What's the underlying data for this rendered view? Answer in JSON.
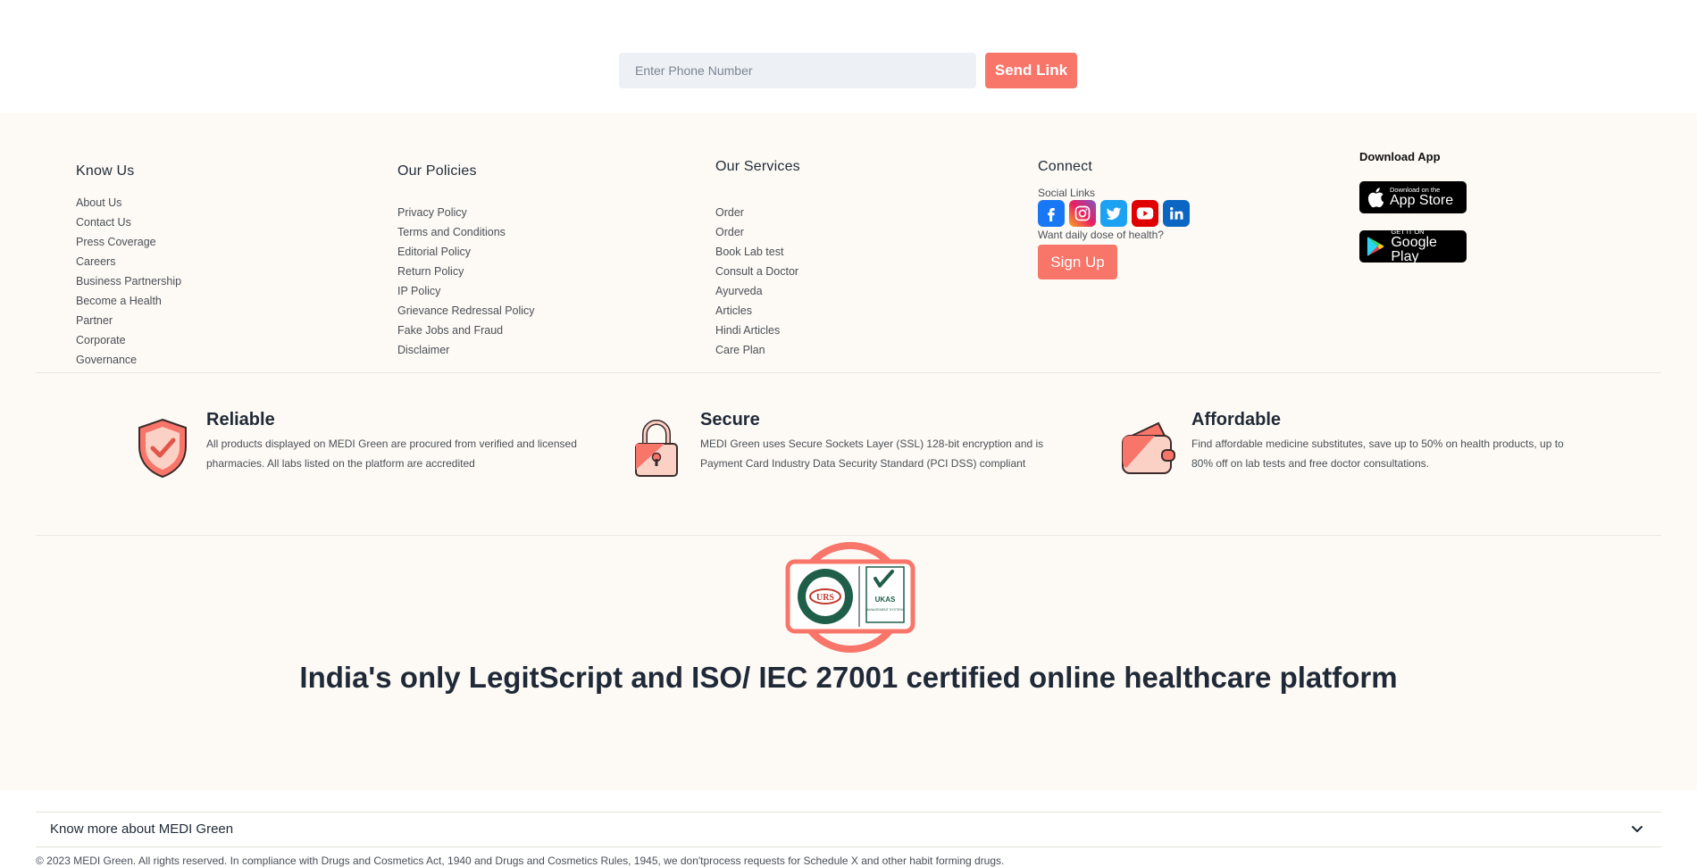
{
  "phone_form": {
    "placeholder": "Enter Phone Number",
    "send_label": "Send Link"
  },
  "footer": {
    "know_us": {
      "heading": "Know Us",
      "items": [
        "About Us",
        "Contact Us",
        "Press Coverage",
        "Careers",
        "Business Partnership",
        "Become a Health",
        "Partner",
        "Corporate",
        "Governance"
      ]
    },
    "policies": {
      "heading": "Our Policies",
      "items": [
        "Privacy Policy",
        "Terms and Conditions",
        "Editorial Policy",
        "Return Policy",
        "IP Policy",
        "Grievance Redressal Policy",
        "Fake Jobs and Fraud",
        "Disclaimer"
      ]
    },
    "services": {
      "heading": "Our Services",
      "items": [
        "Order",
        "Order",
        "Book Lab test",
        "Consult a Doctor",
        "Ayurveda",
        "Articles",
        "Hindi Articles",
        "Care Plan"
      ]
    },
    "connect": {
      "heading": "Connect",
      "social_label": "Social Links",
      "socials": [
        "facebook-icon",
        "instagram-icon",
        "twitter-icon",
        "youtube-icon",
        "linkedin-icon"
      ],
      "health_prompt": "Want daily dose of health?",
      "signup_label": "Sign Up"
    },
    "download": {
      "heading": "Download App",
      "app_store": {
        "line1": "Download on the",
        "line2": "App Store"
      },
      "play_store": {
        "line1": "GET IT ON",
        "line2": "Google Play"
      }
    }
  },
  "trust": [
    {
      "title": "Reliable",
      "desc": "All products displayed on MEDI Green are procured from verified and licensed pharmacies. All labs listed on the platform are accredited",
      "icon": "shield-check-icon"
    },
    {
      "title": "Secure",
      "desc": "MEDI Green uses Secure Sockets Layer (SSL) 128-bit encryption and is Payment Card Industry Data Security Standard (PCI DSS) compliant",
      "icon": "padlock-icon"
    },
    {
      "title": "Affordable",
      "desc": "Find affordable medicine substitutes, save up to 50% on health products, up to 80% off on lab tests and free doctor consultations.",
      "icon": "wallet-icon"
    }
  ],
  "cert": {
    "urs_text": "URS",
    "ukas_text": "UKAS",
    "ukas_sub": "MANAGEMENT SYSTEMS",
    "headline": "India's only LegitScript and ISO/ IEC 27001 certified online healthcare platform"
  },
  "know_more": {
    "label": "Know more about MEDI Green"
  },
  "copyright": "© 2023 MEDI Green. All rights reserved. In compliance with Drugs and Cosmetics Act, 1940 and Drugs and Cosmetics Rules, 1945, we don'tprocess requests for Schedule X and other habit forming drugs.",
  "colors": {
    "accent": "#f8756a",
    "footer_bg": "#fdfaf5",
    "input_bg": "#edf1f5"
  }
}
